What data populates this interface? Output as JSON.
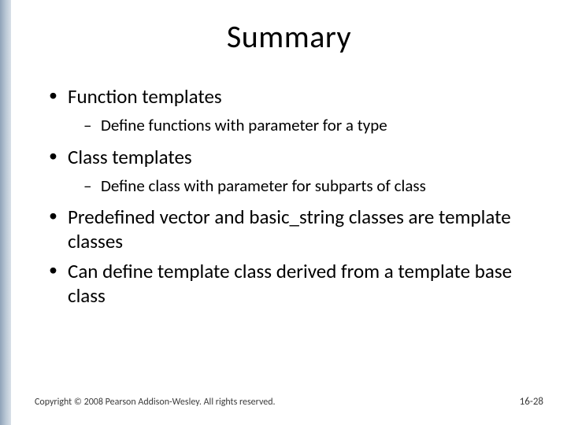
{
  "title": "Summary",
  "bullets": [
    {
      "text": "Function templates",
      "sub": [
        "Define functions with parameter for a type"
      ]
    },
    {
      "text": "Class templates",
      "sub": [
        "Define class with parameter for subparts of class"
      ]
    },
    {
      "text": "Predefined vector and basic_string classes are template classes",
      "sub": []
    },
    {
      "text": "Can define template class derived from a template base class",
      "sub": []
    }
  ],
  "footer": "Copyright © 2008 Pearson Addison-Wesley. All rights reserved.",
  "page_number": "16-28"
}
